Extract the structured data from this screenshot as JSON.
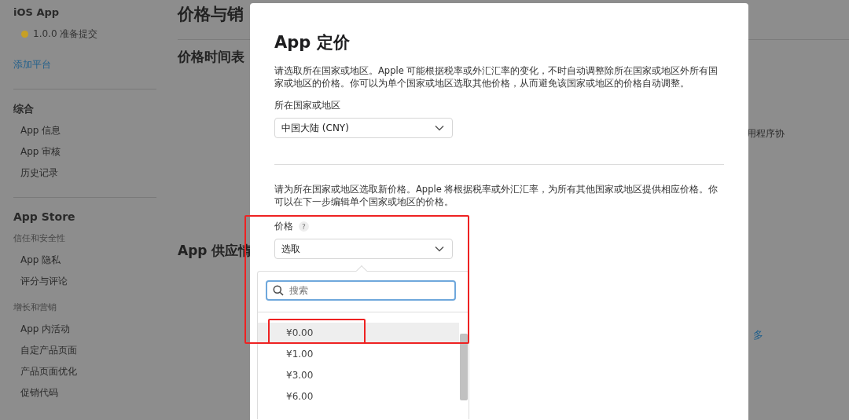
{
  "sidebar": {
    "app_title": "iOS App",
    "version_status": "1.0.0 准备提交",
    "add_platform_link": "添加平台",
    "groups": [
      {
        "title": "综合",
        "kind": "section",
        "items": [
          {
            "kind": "item",
            "label": "App 信息"
          },
          {
            "kind": "item",
            "label": "App 审核"
          },
          {
            "kind": "item",
            "label": "历史记录"
          }
        ]
      },
      {
        "title": "App Store",
        "kind": "store",
        "items": [
          {
            "kind": "subheader",
            "label": "信任和安全性"
          },
          {
            "kind": "item",
            "label": "App 隐私"
          },
          {
            "kind": "item",
            "label": "评分与评论"
          },
          {
            "kind": "subheader",
            "label": "增长和营销"
          },
          {
            "kind": "item",
            "label": "App 内活动"
          },
          {
            "kind": "item",
            "label": "自定产品页面"
          },
          {
            "kind": "item",
            "label": "产品页面优化"
          },
          {
            "kind": "item",
            "label": "促销代码"
          }
        ]
      }
    ]
  },
  "main": {
    "page_title": "价格与销",
    "schedule_heading": "价格时间表",
    "agreement_text": "用程序协",
    "availability_heading": "App 供应情",
    "more_link": "多"
  },
  "dialog": {
    "title": "App 定价",
    "intro": "请选取所在国家或地区。Apple 可能根据税率或外汇汇率的变化，不时自动调整除所在国家或地区外所有国家或地区的价格。你可以为单个国家或地区选取其他价格，从而避免该国家或地区的价格自动调整。",
    "region_label": "所在国家或地区",
    "region_value": "中国大陆 (CNY)",
    "price_intro": "请为所在国家或地区选取新价格。Apple 将根据税率或外汇汇率，为所有其他国家或地区提供相应价格。你可以在下一步编辑单个国家或地区的价格。",
    "price_label": "价格",
    "help": "?",
    "price_value": "选取",
    "dropdown": {
      "search_placeholder": "搜索",
      "options": [
        {
          "label": "¥0.00",
          "selected": true
        },
        {
          "label": "¥1.00",
          "selected": false
        },
        {
          "label": "¥3.00",
          "selected": false
        },
        {
          "label": "¥6.00",
          "selected": false
        }
      ]
    }
  }
}
